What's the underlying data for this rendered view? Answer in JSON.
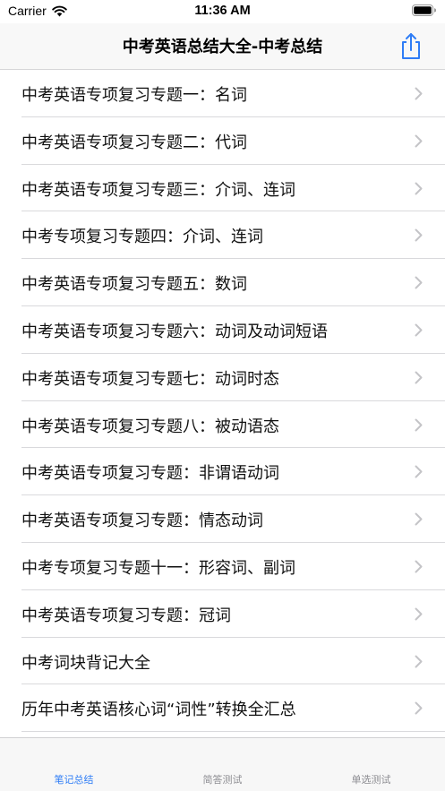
{
  "status": {
    "carrier": "Carrier",
    "time": "11:36 AM"
  },
  "nav": {
    "title": "中考英语总结大全-中考总结"
  },
  "colors": {
    "accent": "#2f7df6",
    "inactive_tab": "#8e8e93",
    "chevron": "#c4c4c7"
  },
  "icons": {
    "share": "share-icon",
    "chevron": "chevron-right-icon",
    "wifi": "wifi-icon",
    "battery": "battery-icon"
  },
  "list": {
    "items": [
      {
        "label": "中考英语专项复习专题一：名词"
      },
      {
        "label": "中考英语专项复习专题二：代词"
      },
      {
        "label": "中考英语专项复习专题三：介词、连词"
      },
      {
        "label": "中考专项复习专题四：介词、连词"
      },
      {
        "label": "中考英语专项复习专题五：数词"
      },
      {
        "label": "中考英语专项复习专题六：动词及动词短语"
      },
      {
        "label": "中考英语专项复习专题七：动词时态"
      },
      {
        "label": "中考英语专项复习专题八：被动语态"
      },
      {
        "label": "中考英语专项复习专题：非谓语动词"
      },
      {
        "label": "中考英语专项复习专题：情态动词"
      },
      {
        "label": "中考专项复习专题十一：形容词、副词"
      },
      {
        "label": "中考英语专项复习专题：冠词"
      },
      {
        "label": "中考词块背记大全"
      },
      {
        "label": "历年中考英语核心词“词性”转换全汇总"
      }
    ]
  },
  "tabs": [
    {
      "label": "笔记总结",
      "active": true
    },
    {
      "label": "简答测试",
      "active": false
    },
    {
      "label": "单选测试",
      "active": false
    }
  ]
}
